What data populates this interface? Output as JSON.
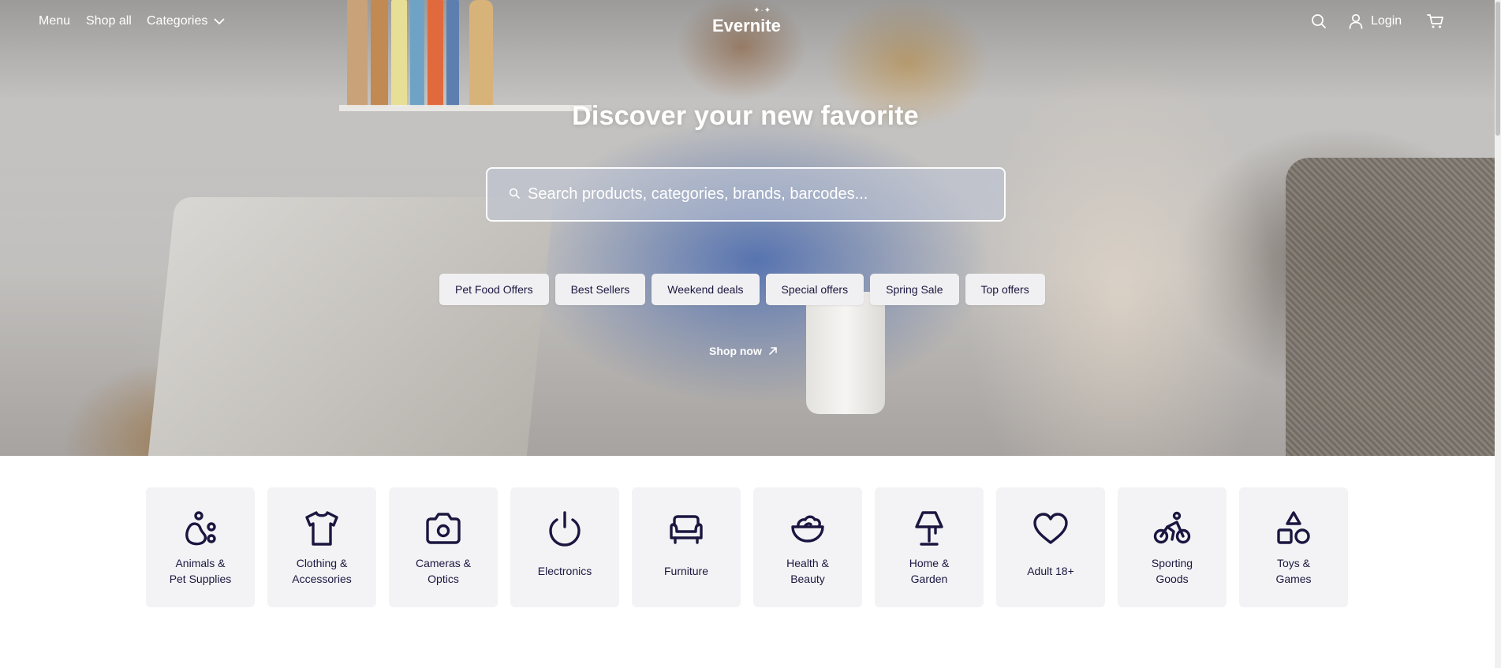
{
  "nav": {
    "menu_label": "Menu",
    "shop_all_label": "Shop all",
    "categories_label": "Categories",
    "logo_text": "Evernite",
    "login_label": "Login",
    "icons": [
      "search-icon",
      "user-icon",
      "cart-icon",
      "chevron-down-icon"
    ]
  },
  "hero": {
    "title": "Discover your new favorite",
    "search_placeholder": "Search products, categories, brands, barcodes...",
    "chips": [
      "Pet Food Offers",
      "Best Sellers",
      "Weekend deals",
      "Special offers",
      "Spring Sale",
      "Top offers"
    ],
    "cta_label": "Shop now"
  },
  "categories": [
    {
      "label": "Animals &\nPet Supplies",
      "icon": "paw-icon"
    },
    {
      "label": "Clothing &\nAccessories",
      "icon": "shirt-icon"
    },
    {
      "label": "Cameras &\nOptics",
      "icon": "camera-icon"
    },
    {
      "label": "Electronics",
      "icon": "power-icon"
    },
    {
      "label": "Furniture",
      "icon": "sofa-icon"
    },
    {
      "label": "Health &\nBeauty",
      "icon": "bowl-icon"
    },
    {
      "label": "Home &\nGarden",
      "icon": "lamp-icon"
    },
    {
      "label": "Adult 18+",
      "icon": "heart-icon"
    },
    {
      "label": "Sporting\nGoods",
      "icon": "bicycle-icon"
    },
    {
      "label": "Toys &\nGames",
      "icon": "shapes-icon"
    }
  ],
  "colors": {
    "accent": "#1b1640",
    "tile_bg": "#f3f3f5",
    "chip_bg": "#f0f0f2"
  }
}
